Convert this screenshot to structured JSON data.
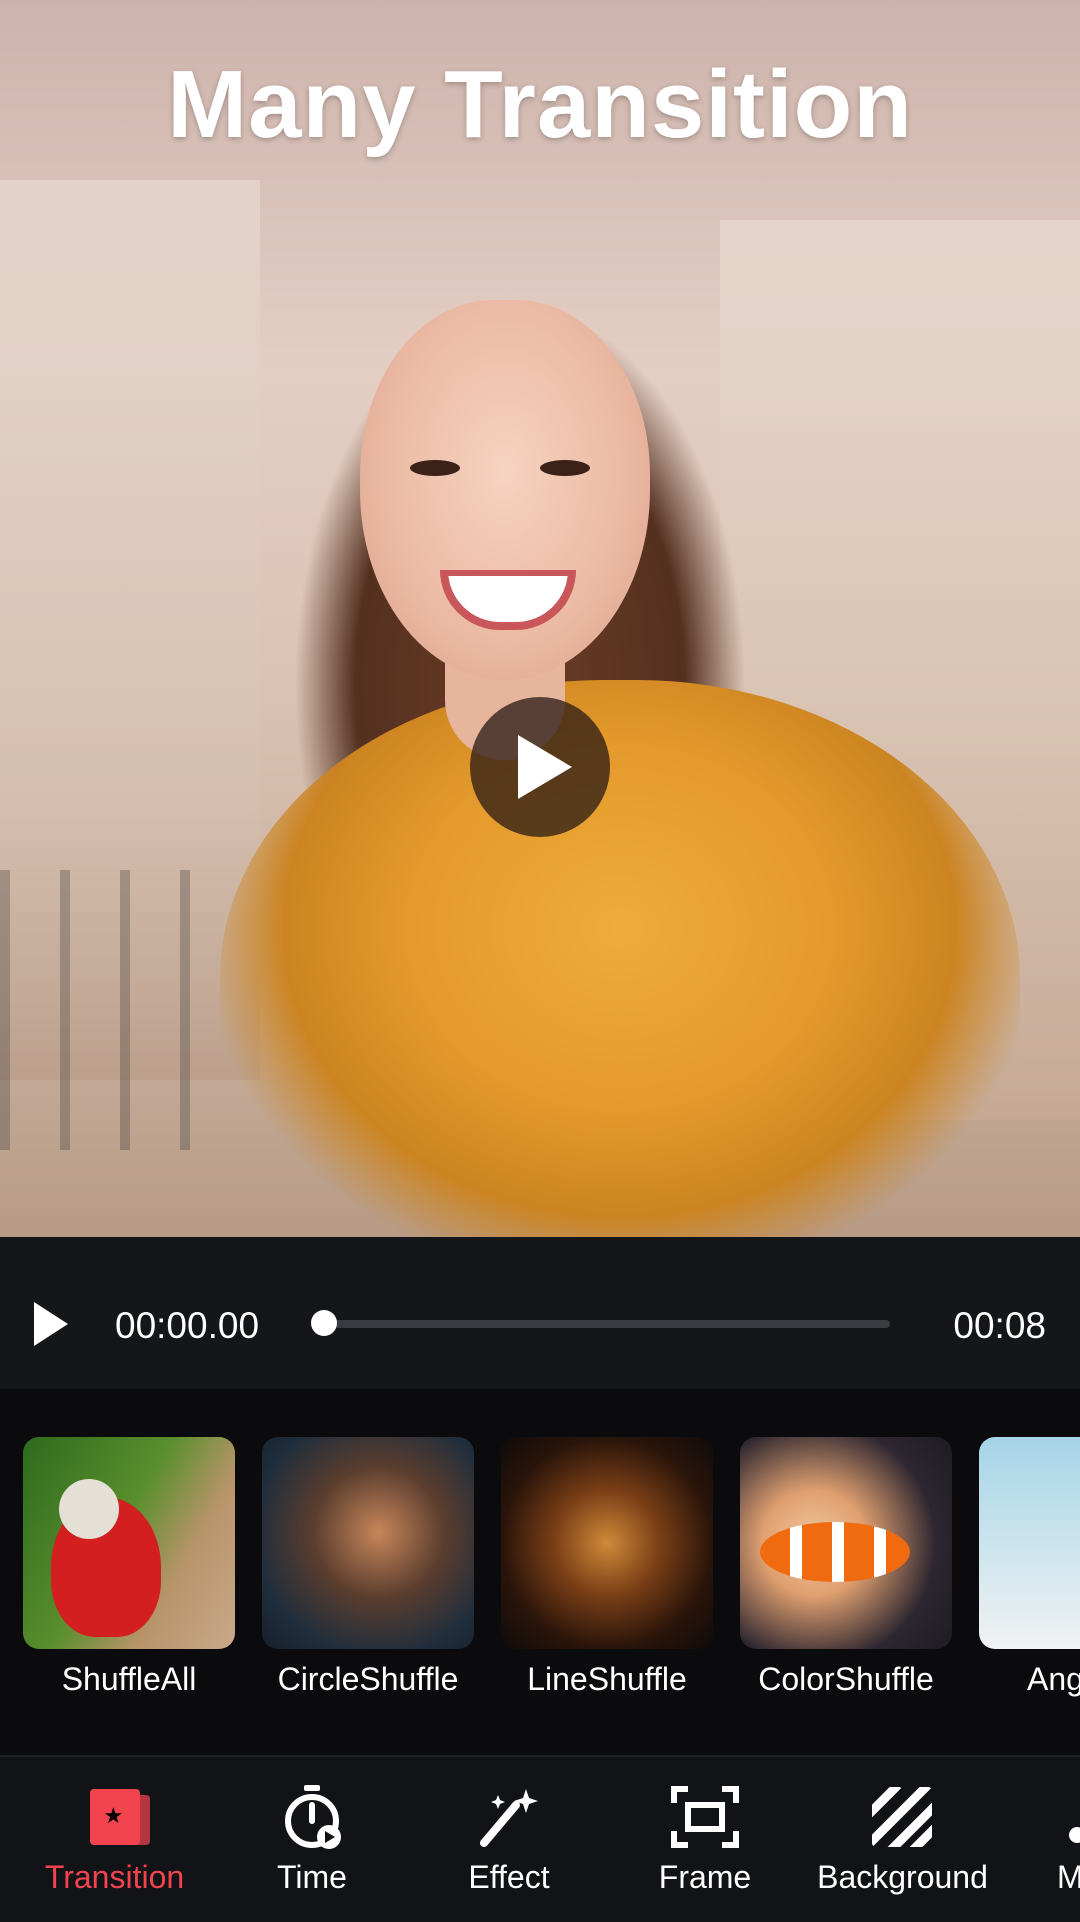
{
  "preview": {
    "title": "Many Transition"
  },
  "player": {
    "current_time": "00:00.00",
    "duration": "00:08",
    "progress": 0.0
  },
  "transitions": [
    {
      "label": "ShuffleAll"
    },
    {
      "label": "CircleShuffle"
    },
    {
      "label": "LineShuffle"
    },
    {
      "label": "ColorShuffle"
    },
    {
      "label": "Ang"
    }
  ],
  "toolbar": {
    "items": [
      {
        "label": "Transition",
        "icon": "transition-icon",
        "active": true
      },
      {
        "label": "Time",
        "icon": "timer-icon",
        "active": false
      },
      {
        "label": "Effect",
        "icon": "magic-wand-icon",
        "active": false
      },
      {
        "label": "Frame",
        "icon": "frame-icon",
        "active": false
      },
      {
        "label": "Background",
        "icon": "background-icon",
        "active": false
      },
      {
        "label": "M",
        "icon": "more-icon",
        "active": false
      }
    ]
  },
  "colors": {
    "accent": "#f2434f",
    "panel": "#15161a",
    "background": "#0b0b0d"
  }
}
